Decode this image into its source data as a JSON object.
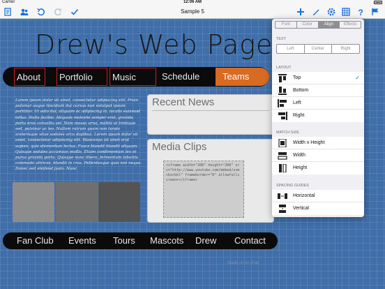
{
  "status_bar": {
    "carrier": "Carrier",
    "time": "12:06 AM"
  },
  "toolbar": {
    "title": "Sample 5",
    "left_icons": [
      "document-icon",
      "people-icon",
      "undo-icon",
      "redo-icon",
      "checkmark-icon"
    ],
    "right_icons": [
      "add-icon",
      "pencil-icon",
      "gear-icon",
      "grid-icon",
      "help-icon",
      "flag-icon"
    ]
  },
  "page": {
    "title": "Drew's Web Page",
    "top_nav": [
      "About",
      "Portfolio",
      "Music",
      "Schedule",
      "Teams"
    ],
    "body_text": "Lorem ipsum dolor sit amet, consectetur adipiscing elit. Proin pulvinar augue tincidunt dui cursus non volutpat ipsum porttitor. Ut odio dui, aliquam ac adipiscing in, iaculis euismod tellus. Nulla facilisi. Aliquam molestie semper erat, gravida porta eros convallis vel. Nam massa urna, mattis ut tristique sed, pulvinar ac leo. Nullam rutrum quam non turpis scelerisque vitae sodales arcu dapibus. Lorem ipsum dolor sit amet, consectetur adipiscing elit. Maecenas sit amet erat sapien, quis elementum lectus. Fusce blandit blandit aliquam. Quisque sodales accumsan mollis. Etiam condimentum leo et purus gravida porta. Quisque nunc libero, fermentum lobortis commodo ultrices, blandit in cras. Pellentesque quis nisi neque. Donec sed eleifend justo. Nunc",
    "recent_posts_title": "Recent News",
    "media_clips_title": "Media Clips",
    "media_embed_code": "<iframe width=\"200\" height=\"200\" src=\"http://www.youtube.com/embed/zsmckzckkl\" frameborder=\"0\" allowfullscreen></iframe>",
    "thumbnail_colors": [
      "#8c8c8c",
      "#6f6f6f",
      "#545454"
    ],
    "bottom_nav": [
      "Fan Club",
      "Events",
      "Tours",
      "Mascots",
      "Drew",
      "Contact"
    ],
    "footer_note": "Made on an iPad"
  },
  "inspector": {
    "tabs": [
      "Font",
      "Color",
      "Align",
      "Effects"
    ],
    "selected_tab": "Align",
    "text_section": "TEXT",
    "text_align_options": [
      "Left",
      "Center",
      "Right"
    ],
    "layout_section": "LAYOUT",
    "layout_options": [
      "Top",
      "Bottom",
      "Left",
      "Right"
    ],
    "layout_selected": "Top",
    "match_size_section": "MATCH SIZE",
    "match_size_options": [
      "Width x Height",
      "Width",
      "Height"
    ],
    "spacing_section": "SPACING GUIDES",
    "spacing_options": [
      "Horizontal",
      "Vertical"
    ],
    "check_mark": "✓"
  },
  "colors": {
    "canvas_blue": "#3f6ea8",
    "nav_black": "#0b0b0b",
    "active_orange": "#d86a21",
    "box_red": "#d21c1c",
    "ios_blue": "#1a6fe0"
  }
}
